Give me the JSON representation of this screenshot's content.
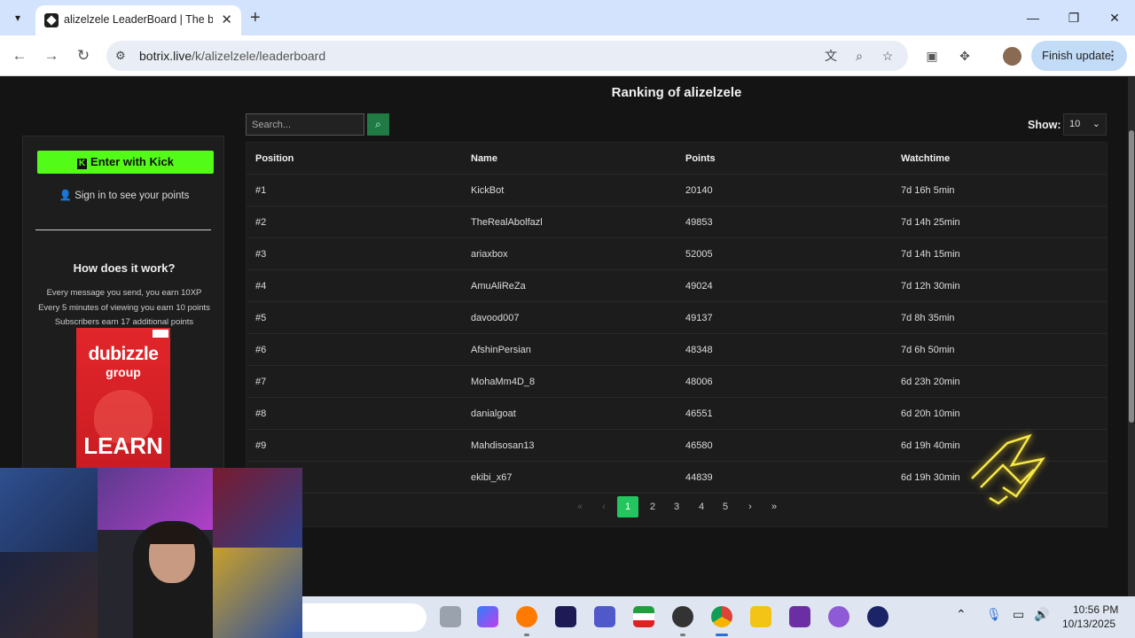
{
  "browser": {
    "tab_title": "alizelzele LeaderBoard | The be",
    "tab_close": "✕",
    "new_tab": "+",
    "url_domain": "botrix.live",
    "url_path": "/k/alizelzele/leaderboard",
    "finish_update": "Finish update"
  },
  "page": {
    "title": "Ranking of alizelzele",
    "search_placeholder": "Search...",
    "show_label": "Show:",
    "show_value": "10"
  },
  "sidebar": {
    "kick_button": "Enter with Kick",
    "signin_text": "Sign in to see your points",
    "how_title": "How does it work?",
    "how_lines": [
      "Every message you send, you earn 10XP",
      "Every 5 minutes of viewing you earn 10 points",
      "Subscribers earn 17 additional points"
    ],
    "ad": {
      "logo": "dubizzle",
      "sub": "group",
      "cta": "LEARN"
    }
  },
  "table": {
    "headers": [
      "Position",
      "Name",
      "Points",
      "Watchtime"
    ],
    "rows": [
      [
        "#1",
        "KickBot",
        "20140",
        "7d 16h 5min"
      ],
      [
        "#2",
        "TheRealAbolfazl",
        "49853",
        "7d 14h 25min"
      ],
      [
        "#3",
        "ariaxbox",
        "52005",
        "7d 14h 15min"
      ],
      [
        "#4",
        "AmuAliReZa",
        "49024",
        "7d 12h 30min"
      ],
      [
        "#5",
        "davood007",
        "49137",
        "7d 8h 35min"
      ],
      [
        "#6",
        "AfshinPersian",
        "48348",
        "7d 6h 50min"
      ],
      [
        "#7",
        "MohaMm4D_8",
        "48006",
        "6d 23h 20min"
      ],
      [
        "#8",
        "danialgoat",
        "46551",
        "6d 20h 10min"
      ],
      [
        "#9",
        "Mahdisosan13",
        "46580",
        "6d 19h 40min"
      ],
      [
        "",
        "ekibi_x67",
        "44839",
        "6d 19h 30min"
      ]
    ]
  },
  "pagination": {
    "first": "«",
    "prev": "‹",
    "pages": [
      "1",
      "2",
      "3",
      "4",
      "5"
    ],
    "active": "1",
    "next": "›",
    "last": "»"
  },
  "taskbar": {
    "time": "10:56 PM",
    "date": "10/13/2025"
  },
  "colors": {
    "kick_green": "#53fc18",
    "active_page": "#22c55e",
    "page_bg": "#141414",
    "ad_red": "#e2262b"
  }
}
